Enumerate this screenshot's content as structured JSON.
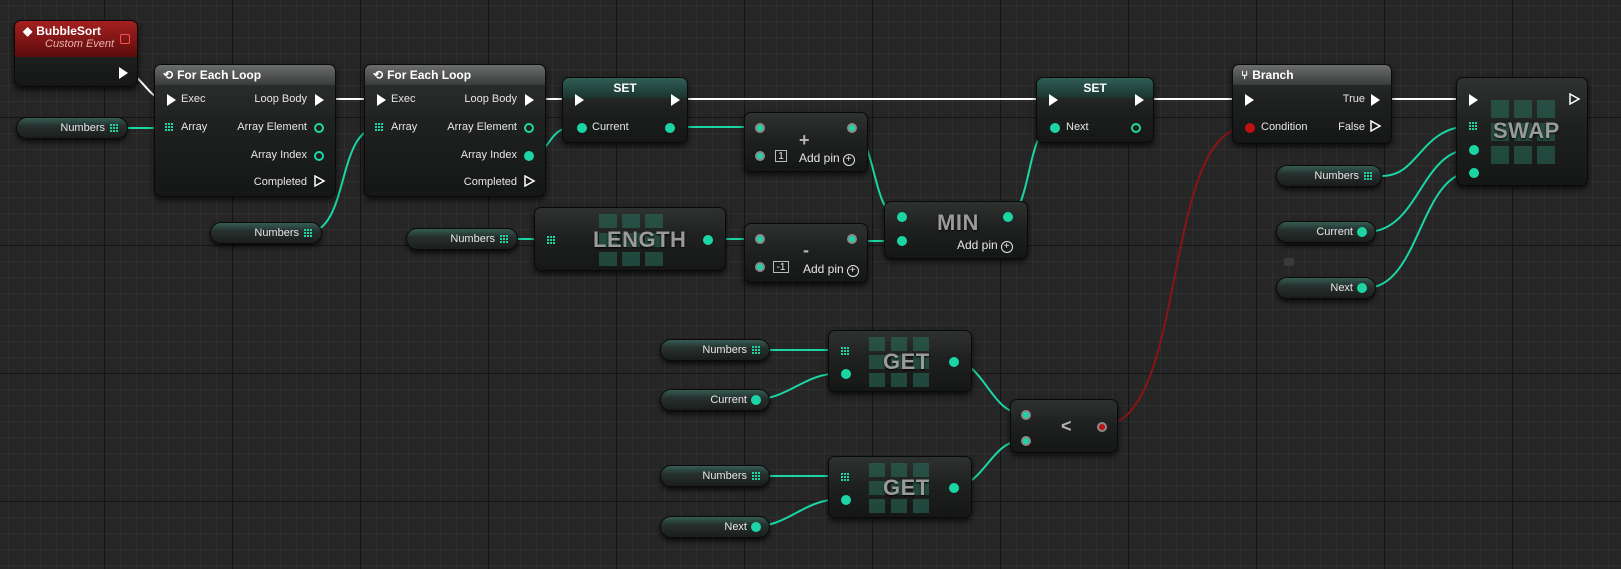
{
  "graph": {
    "event": {
      "title": "BubbleSort",
      "subtitle": "Custom Event"
    },
    "loop1": {
      "title": "For Each Loop",
      "exec": "Exec",
      "array": "Array",
      "loop_body": "Loop Body",
      "array_element": "Array Element",
      "array_index": "Array Index",
      "completed": "Completed"
    },
    "loop2": {
      "title": "For Each Loop",
      "exec": "Exec",
      "array": "Array",
      "loop_body": "Loop Body",
      "array_element": "Array Element",
      "array_index": "Array Index",
      "completed": "Completed"
    },
    "set1": {
      "title": "SET",
      "pin": "Current"
    },
    "set2": {
      "title": "SET",
      "pin": "Next"
    },
    "branch": {
      "title": "Branch",
      "condition": "Condition",
      "true": "True",
      "false": "False"
    },
    "swap": {
      "title": "SWAP"
    },
    "add": {
      "symbol": "+",
      "constant": "1",
      "add_pin": "Add pin"
    },
    "sub": {
      "symbol": "-",
      "constant": "-1",
      "add_pin": "Add pin"
    },
    "min": {
      "title": "MIN",
      "add_pin": "Add pin"
    },
    "length": {
      "title": "LENGTH"
    },
    "get1": {
      "title": "GET"
    },
    "get2": {
      "title": "GET"
    },
    "less": {
      "symbol": "<"
    },
    "vars": {
      "numbers": "Numbers",
      "current": "Current",
      "next": "Next"
    }
  },
  "colors": {
    "exec": "#ffffff",
    "integer": "#1bd6a4",
    "boolean": "#c01010",
    "event_header": "#a52020"
  },
  "icons": {
    "event": "event-diamond-icon",
    "loop": "loop-icon",
    "branch": "branch-icon",
    "array": "array-grid-icon"
  }
}
